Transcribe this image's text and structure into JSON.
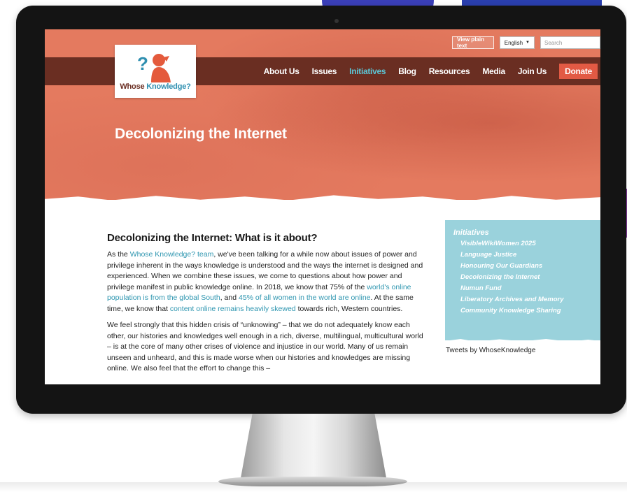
{
  "header": {
    "view_plain_text": "View plain text",
    "language": "English",
    "search_placeholder": "Search",
    "logo": {
      "text_main": "Whose",
      "text_accent": "Knowledge?"
    }
  },
  "nav": {
    "items": [
      {
        "label": "About Us"
      },
      {
        "label": "Issues"
      },
      {
        "label": "Initiatives",
        "active": true
      },
      {
        "label": "Blog"
      },
      {
        "label": "Resources"
      },
      {
        "label": "Media"
      },
      {
        "label": "Join Us"
      }
    ],
    "donate": "Donate"
  },
  "hero": {
    "title": "Decolonizing the Internet"
  },
  "article": {
    "heading": "Decolonizing the Internet: What is it about?",
    "p1": {
      "t1": "As the ",
      "l1": "Whose Knowledge? team",
      "t2": ", we've been talking for a while now about issues of power and privilege inherent in the ways knowledge is understood and the ways the internet is designed and experienced. When we combine these issues, we come to questions about how power and privilege manifest in public knowledge online. In 2018, we know that 75% of the ",
      "l2": "world's online population is from the global South",
      "t3": ", and ",
      "l3": "45% of all women in the world are online",
      "t4": ". At the same time, we know that ",
      "l4": "content online remains heavily skewed",
      "t5": " towards rich, Western countries."
    },
    "p2": "We feel strongly that this hidden crisis of “unknowing” – that we do not adequately know each other, our histories and knowledges well enough in a rich, diverse, multilingual, multicultural world – is at the core of many other crises of violence and injustice in our world. Many of us remain unseen and unheard, and this is made worse when our histories and knowledges are missing online. We also feel that the effort to change this –"
  },
  "sidebar": {
    "title": "Initiatives",
    "items": [
      "VisibleWikiWomen 2025",
      "Language Justice",
      "Honouring Our Guardians",
      "Decolonizing the Internet",
      "Numun Fund",
      "Liberatory Archives and Memory",
      "Community Knowledge Sharing"
    ],
    "tweets": "Tweets by WhoseKnowledge"
  },
  "colors": {
    "hero": "#e47a5f",
    "nav_strip": "#6a2e22",
    "accent_teal": "#5cc6d6",
    "link": "#2e96b0",
    "donate": "#e25a44",
    "sidebar_bg": "#9ad2dc"
  }
}
